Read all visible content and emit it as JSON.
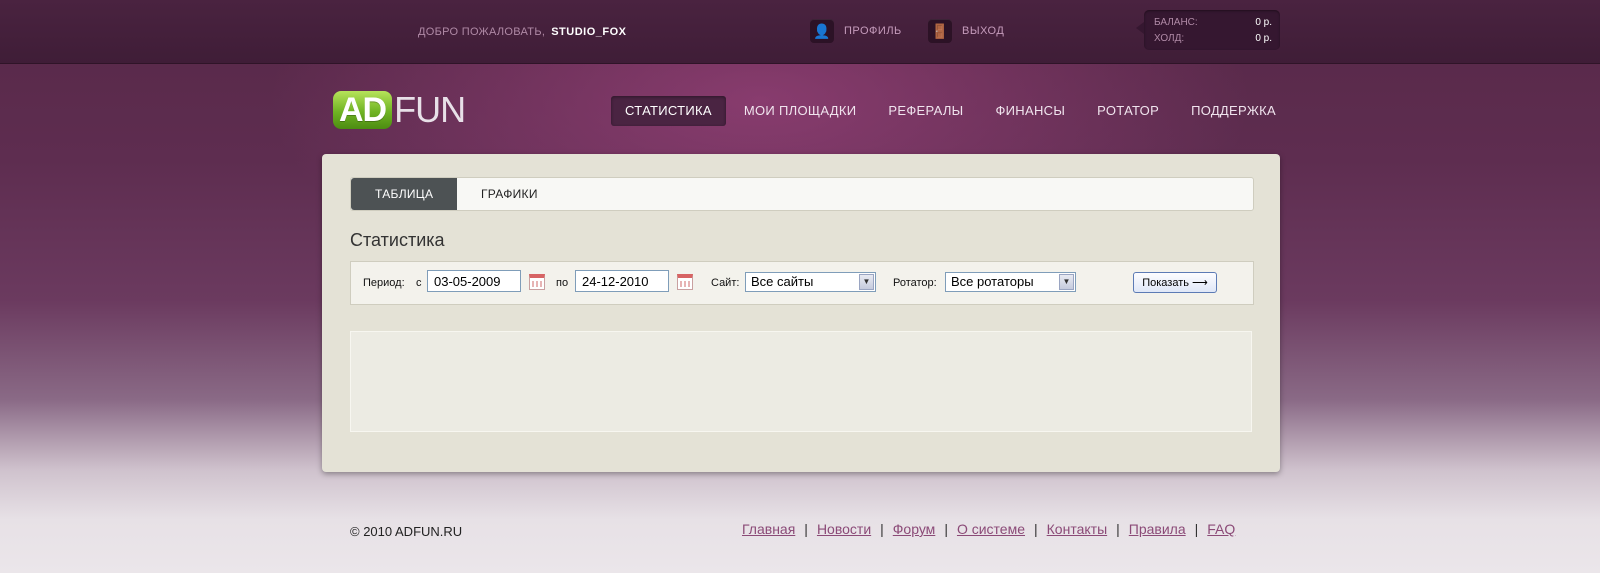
{
  "header": {
    "welcome_label": "ДОБРО ПОЖАЛОВАТЬ,",
    "username": "STUDIO_FOX",
    "profile_label": "ПРОФИЛЬ",
    "logout_label": "ВЫХОД",
    "balance_label": "БАЛАНС:",
    "balance_value": "0 р.",
    "hold_label": "ХОЛД:",
    "hold_value": "0 р."
  },
  "logo": {
    "part1": "AD",
    "part2": "FUN"
  },
  "nav": {
    "items": [
      {
        "label": "СТАТИСТИКА",
        "active": true
      },
      {
        "label": "МОИ ПЛОЩАДКИ"
      },
      {
        "label": "РЕФЕРАЛЫ"
      },
      {
        "label": "ФИНАНСЫ"
      },
      {
        "label": "РОТАТОР"
      },
      {
        "label": "ПОДДЕРЖКА"
      }
    ]
  },
  "tabs": [
    {
      "label": "ТАБЛИЦА",
      "active": true
    },
    {
      "label": "ГРАФИКИ"
    }
  ],
  "section_title": "Статистика",
  "filter": {
    "period_label": "Период:",
    "from_label": "с",
    "from_value": "03-05-2009",
    "to_label": "по",
    "to_value": "24-12-2010",
    "site_label": "Сайт:",
    "site_value": "Все сайты",
    "rotator_label": "Ротатор:",
    "rotator_value": "Все ротаторы",
    "show_button": "Показать ⟶"
  },
  "footer": {
    "copyright": "©  2010 ADFUN.RU",
    "links": [
      "Главная",
      "Новости",
      "Форум",
      "О системе",
      "Контакты",
      "Правила",
      "FAQ"
    ]
  },
  "icons": {
    "profile": "user-icon",
    "logout": "exit-door-icon",
    "calendar": "calendar-icon"
  }
}
